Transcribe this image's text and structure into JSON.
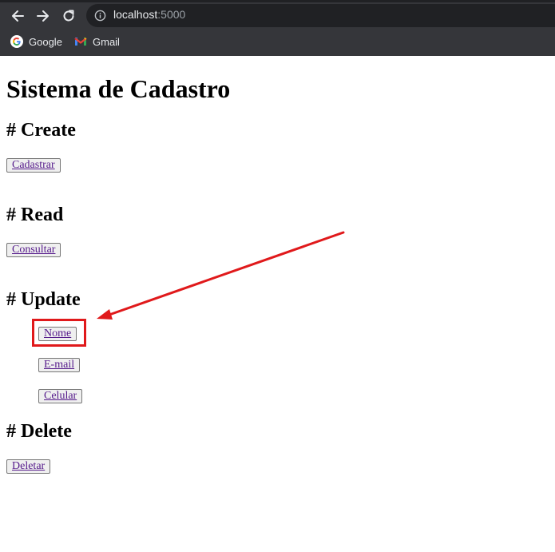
{
  "browser": {
    "url_host": "localhost",
    "url_port": ":5000",
    "bookmarks": [
      {
        "label": "Google",
        "icon": "google-icon"
      },
      {
        "label": "Gmail",
        "icon": "gmail-icon"
      }
    ],
    "icons": {
      "back": "back-arrow-icon",
      "forward": "forward-arrow-icon",
      "reload": "reload-icon",
      "site_info": "info-icon"
    }
  },
  "page": {
    "title": "Sistema de Cadastro",
    "sections": {
      "create": {
        "heading": "# Create",
        "buttons": [
          "Cadastrar"
        ]
      },
      "read": {
        "heading": "# Read",
        "buttons": [
          "Consultar"
        ]
      },
      "update": {
        "heading": "# Update",
        "buttons": [
          "Nome",
          "E-mail",
          "Celular"
        ]
      },
      "delete": {
        "heading": "# Delete",
        "buttons": [
          "Deletar"
        ]
      }
    }
  },
  "annotation": {
    "highlight_color": "#e0191b",
    "target": "Nome"
  }
}
